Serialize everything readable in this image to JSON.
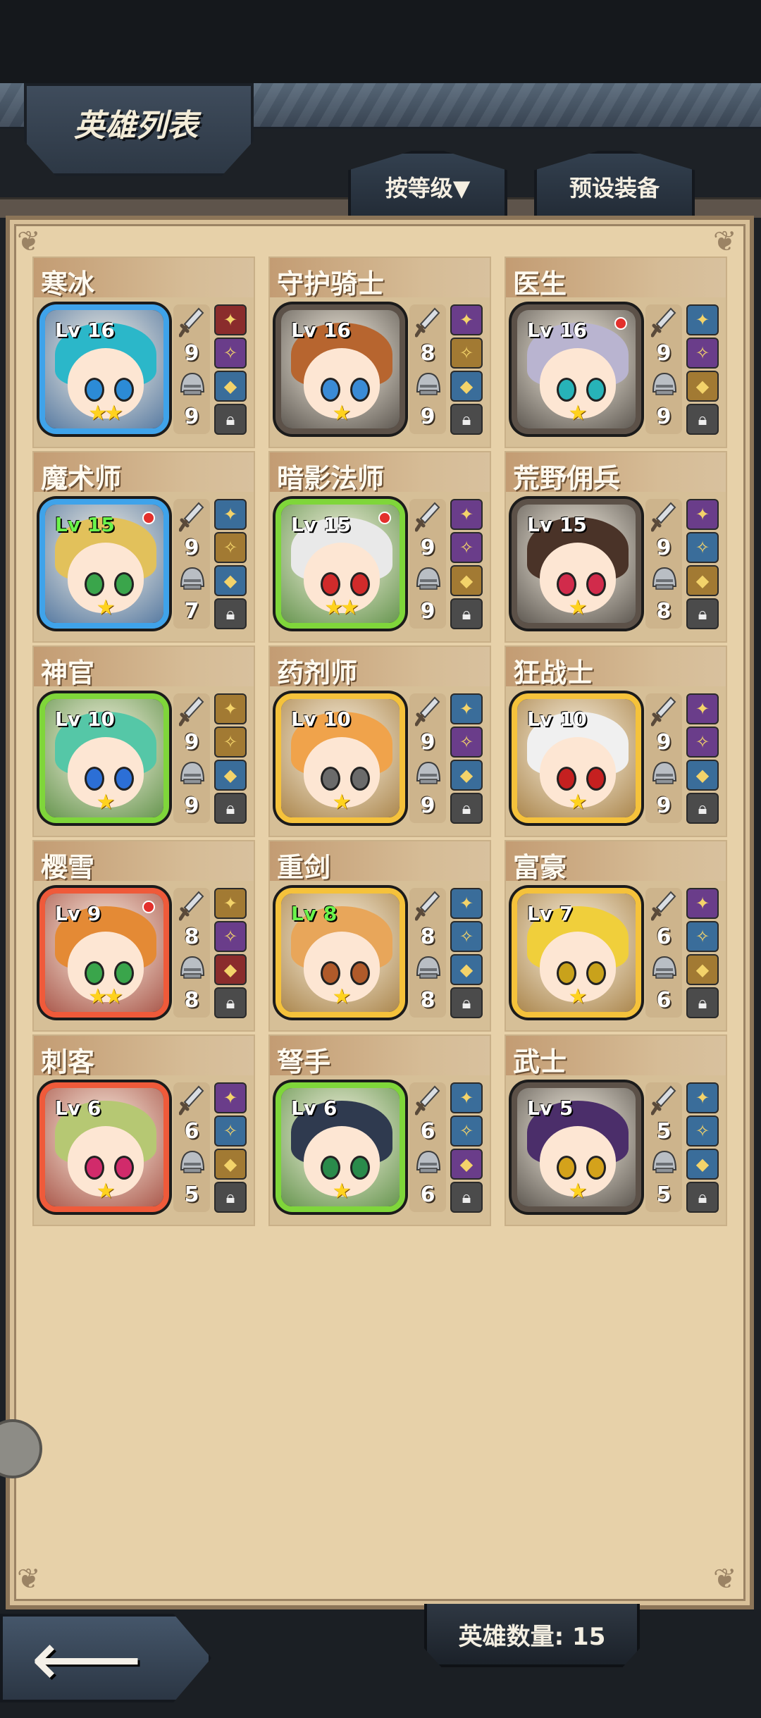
{
  "header": {
    "title": "英雄列表"
  },
  "tabs": {
    "sort_label": "按等级▼",
    "preset_label": "预设装备"
  },
  "footer": {
    "hero_count_label": "英雄数量: 15"
  },
  "heroes": [
    {
      "name": "寒冰",
      "level": "Lv 16",
      "stars": "★★",
      "attack": "9",
      "defense": "9",
      "frame": "blue",
      "lv_green": false,
      "red_dot": false,
      "hair": "#2bb7c9",
      "eye": "#2c8bd6",
      "slots": [
        "red",
        "purple",
        "blue"
      ]
    },
    {
      "name": "守护骑士",
      "level": "Lv 16",
      "stars": "★",
      "attack": "8",
      "defense": "9",
      "frame": "dark",
      "lv_green": false,
      "red_dot": false,
      "hair": "#b7652f",
      "eye": "#3a8bd6",
      "slots": [
        "purple",
        "gold",
        "blue"
      ]
    },
    {
      "name": "医生",
      "level": "Lv 16",
      "stars": "★",
      "attack": "9",
      "defense": "9",
      "frame": "dark",
      "lv_green": false,
      "red_dot": true,
      "hair": "#b9b4d0",
      "eye": "#27b3b8",
      "slots": [
        "blue",
        "purple",
        "gold"
      ]
    },
    {
      "name": "魔术师",
      "level": "Lv 15",
      "stars": "★",
      "attack": "9",
      "defense": "7",
      "frame": "blue",
      "lv_green": true,
      "red_dot": true,
      "hair": "#e2c15b",
      "eye": "#3aa54b",
      "slots": [
        "blue",
        "gold",
        "blue"
      ]
    },
    {
      "name": "暗影法师",
      "level": "Lv 15",
      "stars": "★★",
      "attack": "9",
      "defense": "9",
      "frame": "green",
      "lv_green": false,
      "red_dot": true,
      "hair": "#e9e9e9",
      "eye": "#d12b2b",
      "slots": [
        "purple",
        "purple",
        "gold"
      ]
    },
    {
      "name": "荒野佣兵",
      "level": "Lv 15",
      "stars": "★",
      "attack": "9",
      "defense": "8",
      "frame": "dark",
      "lv_green": false,
      "red_dot": false,
      "hair": "#4a3328",
      "eye": "#d12b4b",
      "slots": [
        "purple",
        "blue",
        "gold"
      ]
    },
    {
      "name": "神官",
      "level": "Lv 10",
      "stars": "★",
      "attack": "9",
      "defense": "9",
      "frame": "green",
      "lv_green": false,
      "red_dot": false,
      "hair": "#55c7a7",
      "eye": "#2c6fd6",
      "slots": [
        "gold",
        "gold",
        "blue"
      ]
    },
    {
      "name": "药剂师",
      "level": "Lv 10",
      "stars": "★",
      "attack": "9",
      "defense": "9",
      "frame": "gold",
      "lv_green": false,
      "red_dot": false,
      "hair": "#f0a34b",
      "eye": "#6b6b6b",
      "slots": [
        "blue",
        "purple",
        "blue"
      ]
    },
    {
      "name": "狂战士",
      "level": "Lv 10",
      "stars": "★",
      "attack": "9",
      "defense": "9",
      "frame": "gold",
      "lv_green": false,
      "red_dot": false,
      "hair": "#f0f0f0",
      "eye": "#c52020",
      "slots": [
        "purple",
        "purple",
        "blue"
      ]
    },
    {
      "name": "樱雪",
      "level": "Lv 9",
      "stars": "★★",
      "attack": "8",
      "defense": "8",
      "frame": "red",
      "lv_green": false,
      "red_dot": true,
      "hair": "#e48a35",
      "eye": "#3aa54b",
      "slots": [
        "gold",
        "purple",
        "red"
      ]
    },
    {
      "name": "重剑",
      "level": "Lv 8",
      "stars": "★",
      "attack": "8",
      "defense": "8",
      "frame": "gold",
      "lv_green": true,
      "red_dot": false,
      "hair": "#e8a65a",
      "eye": "#b05a2a",
      "slots": [
        "blue",
        "blue",
        "blue"
      ]
    },
    {
      "name": "富豪",
      "level": "Lv 7",
      "stars": "★",
      "attack": "6",
      "defense": "6",
      "frame": "gold",
      "lv_green": false,
      "red_dot": false,
      "hair": "#f0cf3b",
      "eye": "#c9a21b",
      "slots": [
        "purple",
        "blue",
        "gold"
      ]
    },
    {
      "name": "刺客",
      "level": "Lv 6",
      "stars": "★",
      "attack": "6",
      "defense": "5",
      "frame": "red",
      "lv_green": false,
      "red_dot": false,
      "hair": "#b6c873",
      "eye": "#d12b6b",
      "slots": [
        "purple",
        "blue",
        "gold"
      ]
    },
    {
      "name": "弩手",
      "level": "Lv 6",
      "stars": "★",
      "attack": "6",
      "defense": "6",
      "frame": "green",
      "lv_green": false,
      "red_dot": false,
      "hair": "#2f3a4f",
      "eye": "#2a8b4b",
      "slots": [
        "blue",
        "blue",
        "purple"
      ]
    },
    {
      "name": "武士",
      "level": "Lv 5",
      "stars": "★",
      "attack": "5",
      "defense": "5",
      "frame": "dark",
      "lv_green": false,
      "red_dot": false,
      "hair": "#4b2e6a",
      "eye": "#d4a21b",
      "slots": [
        "blue",
        "blue",
        "blue"
      ]
    }
  ]
}
